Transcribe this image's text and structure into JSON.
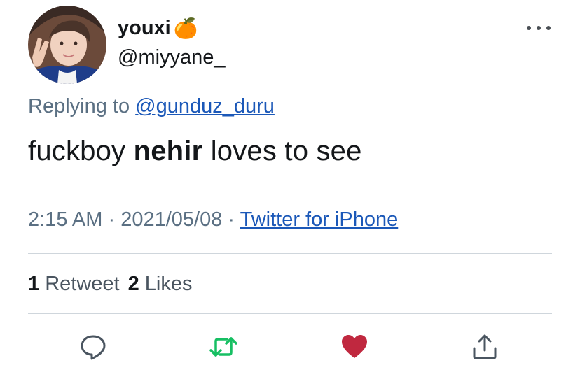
{
  "user": {
    "display_name": "youxi",
    "emoji": "🍊",
    "handle": "@miyyane_"
  },
  "reply": {
    "prefix": "Replying to ",
    "to_handle": "@gunduz_duru"
  },
  "tweet": {
    "text_before": "fuckboy ",
    "text_bold": "nehir",
    "text_after": " loves to see"
  },
  "meta": {
    "time": "2:15 AM",
    "sep1": " · ",
    "date": "2021/05/08",
    "sep2": " · ",
    "source": "Twitter for iPhone"
  },
  "stats": {
    "retweet_count": "1",
    "retweet_label": "Retweet",
    "like_count": "2",
    "like_label": "Likes"
  },
  "colors": {
    "retweet": "#17bf63",
    "like": "#c0283f",
    "icon": "#4a5560"
  },
  "icons": [
    "reply-icon",
    "retweet-icon",
    "like-icon",
    "share-icon",
    "more-icon"
  ]
}
